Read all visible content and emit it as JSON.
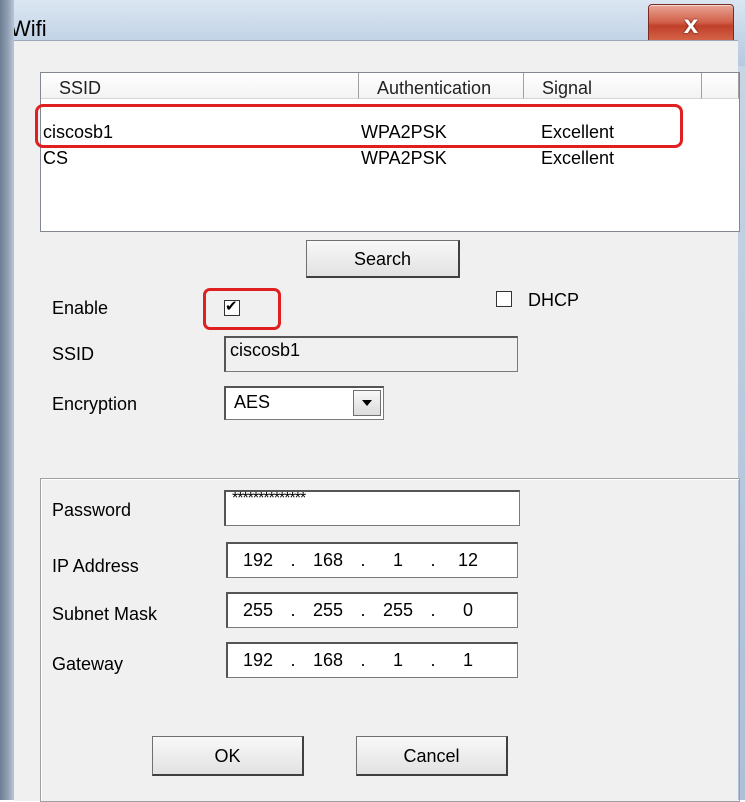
{
  "window": {
    "title": "Wifi",
    "close_icon": "close-icon",
    "close_glyph": "x"
  },
  "network_list": {
    "columns": [
      "SSID",
      "Authentication",
      "Signal"
    ],
    "rows": [
      {
        "ssid": "ciscosb1",
        "auth": "WPA2PSK",
        "signal": "Excellent"
      },
      {
        "ssid": "CS",
        "auth": "WPA2PSK",
        "signal": "Excellent"
      }
    ]
  },
  "search_button": "Search",
  "enable": {
    "label": "Enable",
    "checked": true,
    "check_glyph": "✔"
  },
  "dhcp": {
    "label": "DHCP",
    "checked": false
  },
  "ssid": {
    "label": "SSID",
    "value": "ciscosb1"
  },
  "encryption": {
    "label": "Encryption",
    "value": "AES",
    "dropdown_icon": "chevron-down-icon"
  },
  "password": {
    "label": "Password",
    "value": "**************"
  },
  "ip_address": {
    "label": "IP Address",
    "octets": [
      "192",
      "168",
      "1",
      "12"
    ]
  },
  "subnet_mask": {
    "label": "Subnet Mask",
    "octets": [
      "255",
      "255",
      "255",
      "0"
    ]
  },
  "gateway": {
    "label": "Gateway",
    "octets": [
      "192",
      "168",
      "1",
      "1"
    ]
  },
  "ok_button": "OK",
  "cancel_button": "Cancel",
  "colors": {
    "highlight": "#e02020",
    "title_bar": "#c5d5e8",
    "close_button": "#c0402a"
  }
}
